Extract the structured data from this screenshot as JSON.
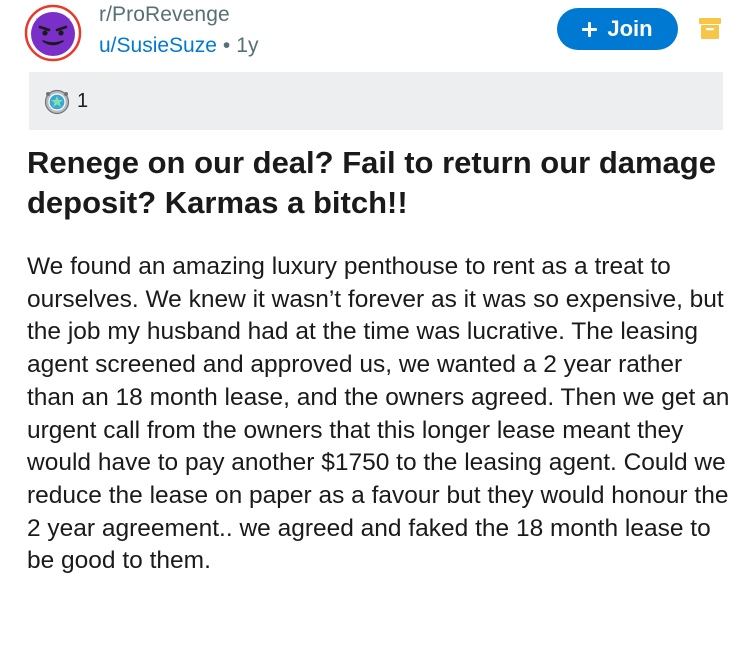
{
  "post": {
    "subreddit": "r/ProRevenge",
    "author": "u/SusieSuze",
    "separator": "•",
    "age": "1y",
    "join_label": "Join",
    "award_count": "1",
    "title": "Renege on our deal? Fail to return our damage deposit? Karmas a bitch!!",
    "body": "We found an amazing luxury penthouse to rent as a treat to ourselves. We knew it wasn’t forever as it was so expensive, but the job my husband had at the time was lucrative. The leasing agent screened and approved us, we wanted a 2 year rather than an 18 month lease, and the owners agreed. Then we get an urgent call from the owners that this longer lease meant they would have to pay another $1750 to the leasing agent. Could we reduce the lease on paper as a favour but they would honour the 2 year agreement.. we agreed and faked the 18 month lease to be good to them."
  },
  "icons": {
    "avatar": "subreddit-avatar-devil-face",
    "join": "plus-icon",
    "menu": "archive-box-icon",
    "award": "award-medal-icon"
  },
  "colors": {
    "accent": "#0079d3",
    "avatar_purple": "#7a2fc9",
    "avatar_ring": "#e8392d",
    "awards_bg": "#edeef0",
    "menu_yellow": "#f7c548"
  }
}
